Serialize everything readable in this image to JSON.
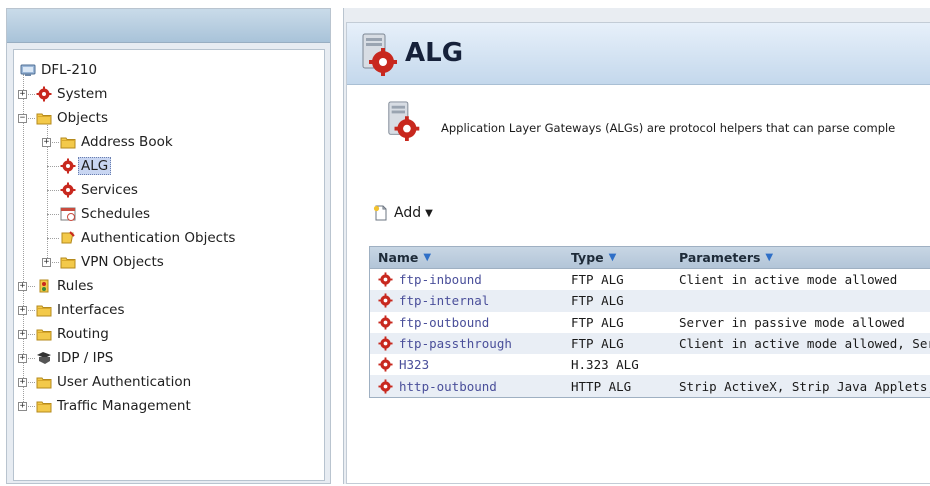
{
  "tree": {
    "root": "DFL-210",
    "items": [
      {
        "label": "System",
        "level": 1,
        "expander": "+"
      },
      {
        "label": "Objects",
        "level": 1,
        "expander": "-"
      },
      {
        "label": "Address Book",
        "level": 2,
        "expander": "+"
      },
      {
        "label": "ALG",
        "level": 2,
        "selected": true
      },
      {
        "label": "Services",
        "level": 2
      },
      {
        "label": "Schedules",
        "level": 2
      },
      {
        "label": "Authentication Objects",
        "level": 2
      },
      {
        "label": "VPN Objects",
        "level": 2,
        "expander": "+"
      },
      {
        "label": "Rules",
        "level": 1,
        "expander": "+"
      },
      {
        "label": "Interfaces",
        "level": 1,
        "expander": "+"
      },
      {
        "label": "Routing",
        "level": 1,
        "expander": "+"
      },
      {
        "label": "IDP / IPS",
        "level": 1,
        "expander": "+"
      },
      {
        "label": "User Authentication",
        "level": 1,
        "expander": "+"
      },
      {
        "label": "Traffic Management",
        "level": 1,
        "expander": "+"
      }
    ]
  },
  "page": {
    "title": "ALG",
    "description": "Application Layer Gateways (ALGs) are protocol helpers that can parse comple"
  },
  "toolbar": {
    "add_label": "Add"
  },
  "grid": {
    "columns": [
      "Name",
      "Type",
      "Parameters"
    ],
    "rows": [
      {
        "name": "ftp-inbound",
        "type": "FTP ALG",
        "parameters": "Client in active mode allowed"
      },
      {
        "name": "ftp-internal",
        "type": "FTP ALG",
        "parameters": ""
      },
      {
        "name": "ftp-outbound",
        "type": "FTP ALG",
        "parameters": "Server in passive mode allowed"
      },
      {
        "name": "ftp-passthrough",
        "type": "FTP ALG",
        "parameters": "Client in active mode allowed, Ser"
      },
      {
        "name": "H323",
        "type": "H.323 ALG",
        "parameters": ""
      },
      {
        "name": "http-outbound",
        "type": "HTTP ALG",
        "parameters": "Strip ActiveX, Strip Java Applets, S"
      }
    ]
  },
  "colors": {
    "accent": "#2f6fc7",
    "alg_red": "#c8281e",
    "folder_yellow": "#f3c94a",
    "header_blue": "#b3c5d8"
  }
}
